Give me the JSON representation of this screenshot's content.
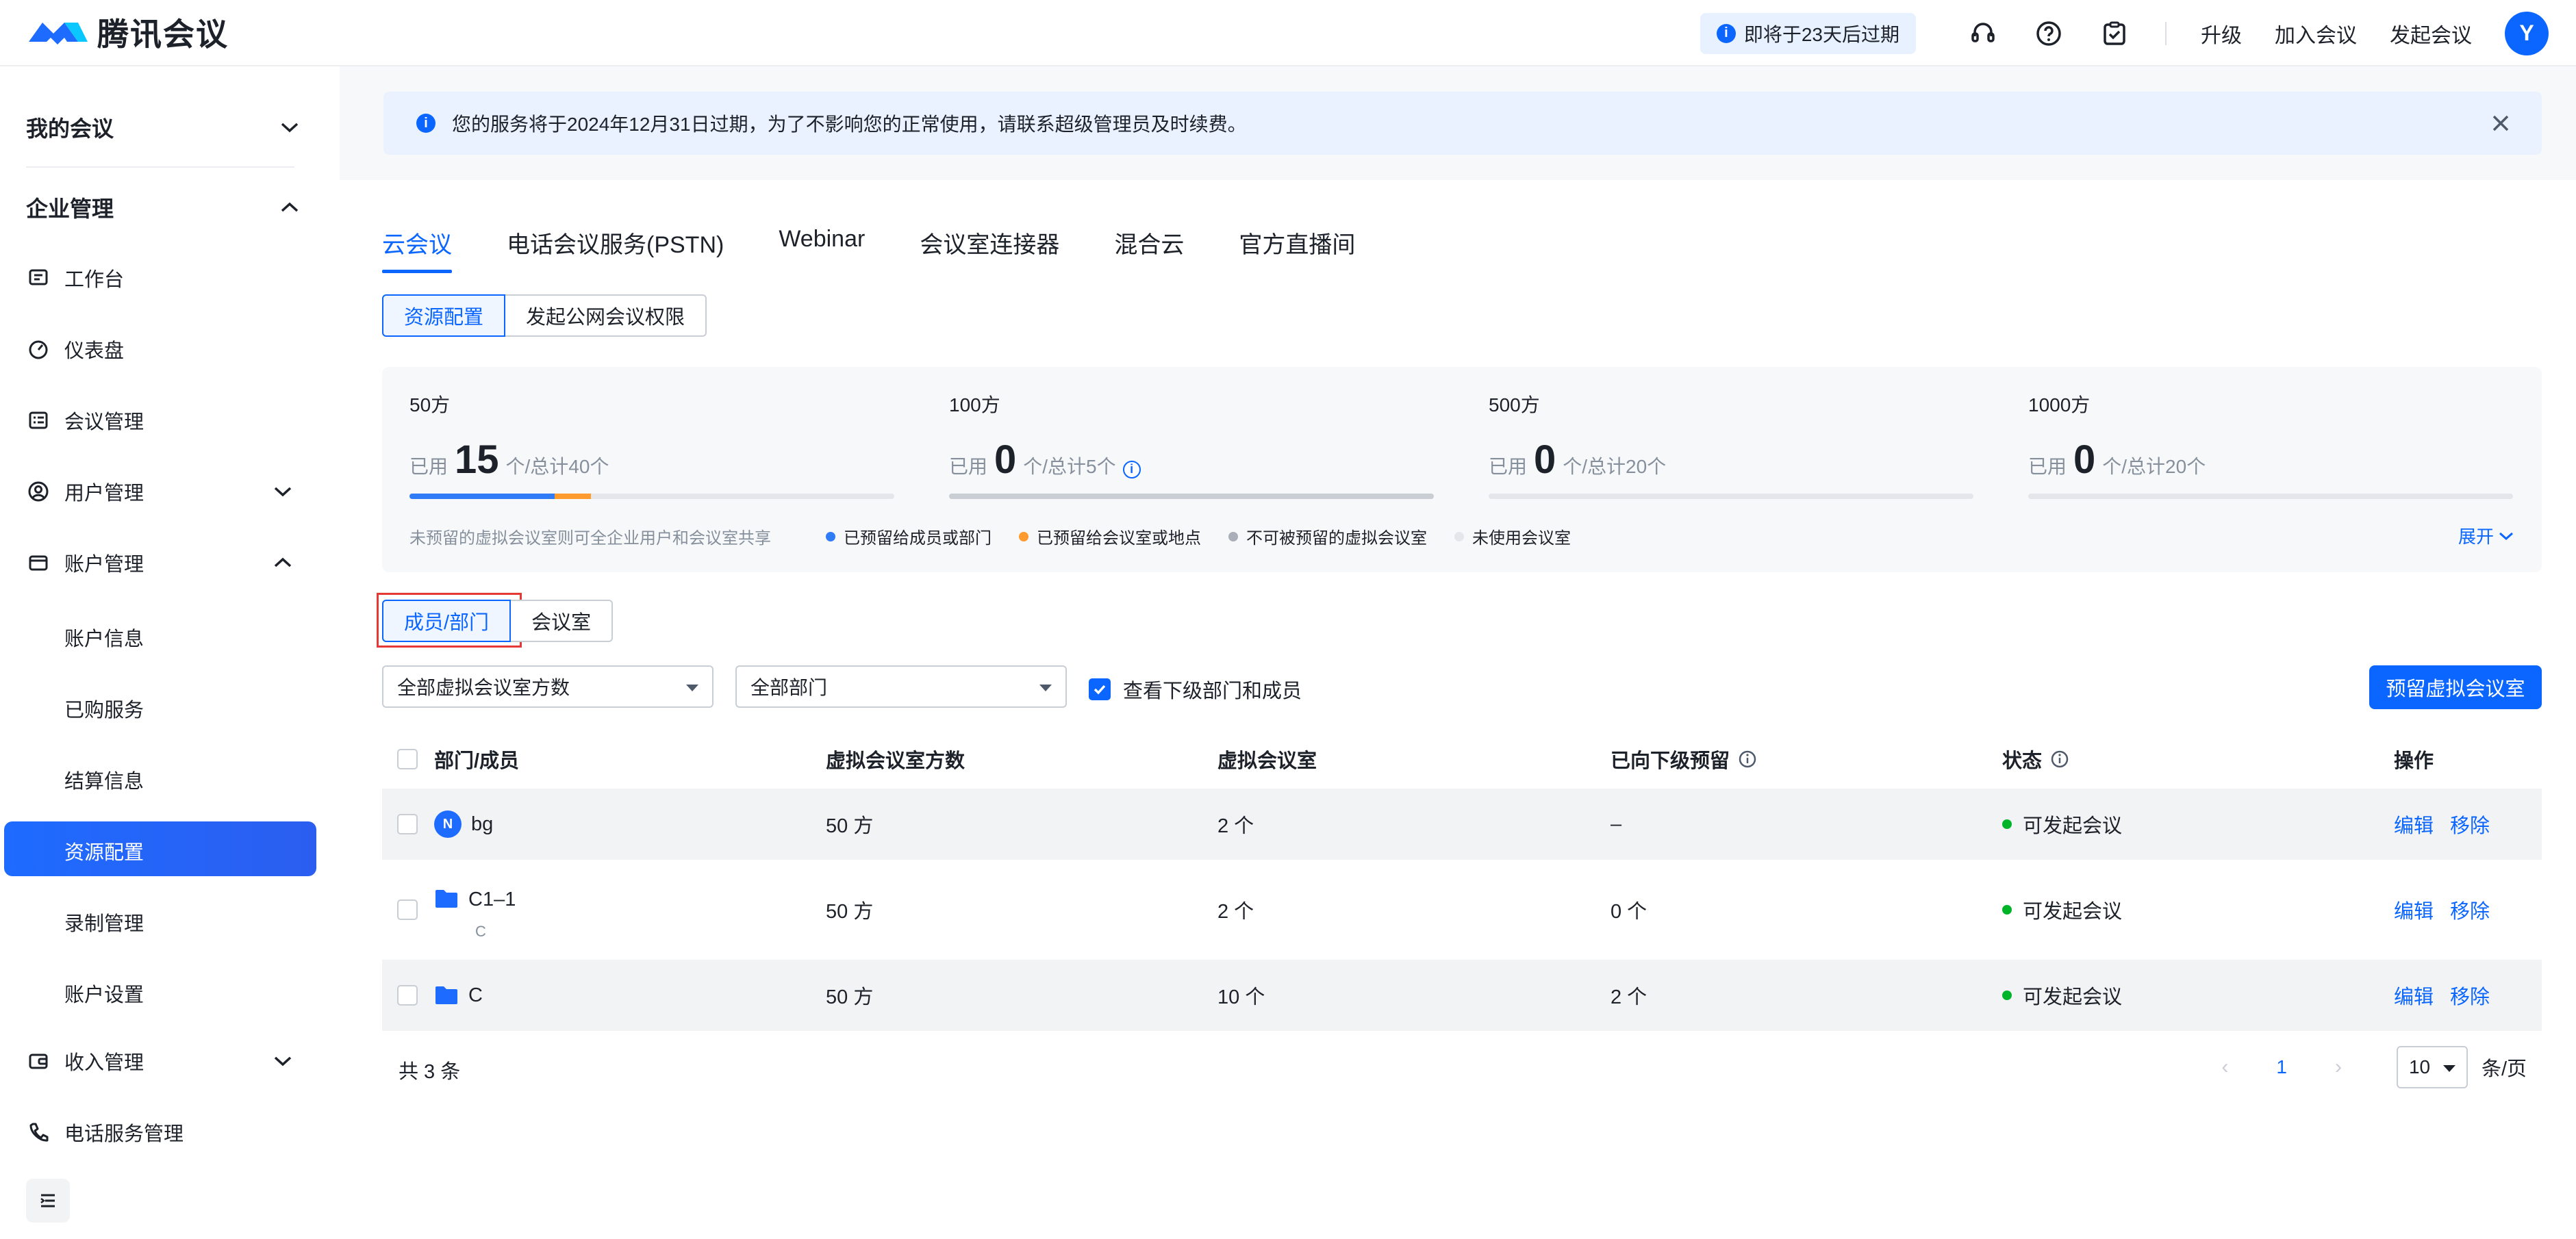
{
  "app": {
    "title": "腾讯会议"
  },
  "header": {
    "expire_text": "即将于23天后过期",
    "links": [
      "升级",
      "加入会议",
      "发起会议"
    ],
    "avatar_letter": "Y"
  },
  "sidebar": {
    "group_my_meetings": "我的会议",
    "group_enterprise": "企业管理",
    "items": [
      {
        "label": "工作台",
        "icon": "workbench-icon"
      },
      {
        "label": "仪表盘",
        "icon": "dashboard-icon"
      },
      {
        "label": "会议管理",
        "icon": "meeting-list-icon"
      },
      {
        "label": "用户管理",
        "icon": "user-icon"
      },
      {
        "label": "账户管理",
        "icon": "account-icon"
      }
    ],
    "account_sub": [
      "账户信息",
      "已购服务",
      "结算信息",
      "资源配置",
      "录制管理",
      "账户设置"
    ],
    "active": "资源配置",
    "revenue": "收入管理",
    "phone_service": "电话服务管理"
  },
  "notice": {
    "text": "您的服务将于2024年12月31日过期，为了不影响您的正常使用，请联系超级管理员及时续费。"
  },
  "tabs": [
    "云会议",
    "电话会议服务(PSTN)",
    "Webinar",
    "会议室连接器",
    "混合云",
    "官方直播间"
  ],
  "active_tab": "云会议",
  "subtabs": [
    "资源配置",
    "发起公网会议权限"
  ],
  "stats": [
    {
      "title": "50方",
      "used_label": "已用",
      "used": "15",
      "total_label": "个/总计40个",
      "used_fraction": 0.375,
      "member_fraction": 0.3,
      "room_fraction": 0.075
    },
    {
      "title": "100方",
      "used_label": "已用",
      "used": "0",
      "total_label": "个/总计5个",
      "used_fraction": 0
    },
    {
      "title": "500方",
      "used_label": "已用",
      "used": "0",
      "total_label": "个/总计20个",
      "used_fraction": 0
    },
    {
      "title": "1000方",
      "used_label": "已用",
      "used": "0",
      "total_label": "个/总计20个",
      "used_fraction": 0
    }
  ],
  "legend": {
    "note": "未预留的虚拟会议室则可全企业用户和会议室共享",
    "items": [
      {
        "label": "已预留给成员或部门",
        "color": "#2f7cf6"
      },
      {
        "label": "已预留给会议室或地点",
        "color": "#ff9a2e"
      },
      {
        "label": "不可被预留的虚拟会议室",
        "color": "#a9aeb8"
      },
      {
        "label": "未使用会议室",
        "color": "#e5e6eb"
      }
    ],
    "expand": "展开"
  },
  "view_toggle": [
    "成员/部门",
    "会议室"
  ],
  "filters": {
    "capacity": "全部虚拟会议室方数",
    "department": "全部部门",
    "include_sub": "查看下级部门和成员",
    "reserve_button": "预留虚拟会议室"
  },
  "table": {
    "columns": [
      "部门/成员",
      "虚拟会议室方数",
      "虚拟会议室",
      "已向下级预留",
      "状态",
      "操作"
    ],
    "rows": [
      {
        "name": "bg",
        "badge": "N",
        "type": "member",
        "capacity": "50 方",
        "rooms": "2 个",
        "reserved": "–",
        "status": "可发起会议",
        "sub": ""
      },
      {
        "name": "C1–1",
        "type": "folder",
        "capacity": "50 方",
        "rooms": "2 个",
        "reserved": "0 个",
        "status": "可发起会议",
        "sub": "C"
      },
      {
        "name": "C",
        "type": "folder",
        "capacity": "50 方",
        "rooms": "10 个",
        "reserved": "2 个",
        "status": "可发起会议",
        "sub": ""
      }
    ],
    "actions": [
      "编辑",
      "移除"
    ]
  },
  "pagination": {
    "total": "共 3 条",
    "current": "1",
    "page_size": "10",
    "unit": "条/页"
  }
}
